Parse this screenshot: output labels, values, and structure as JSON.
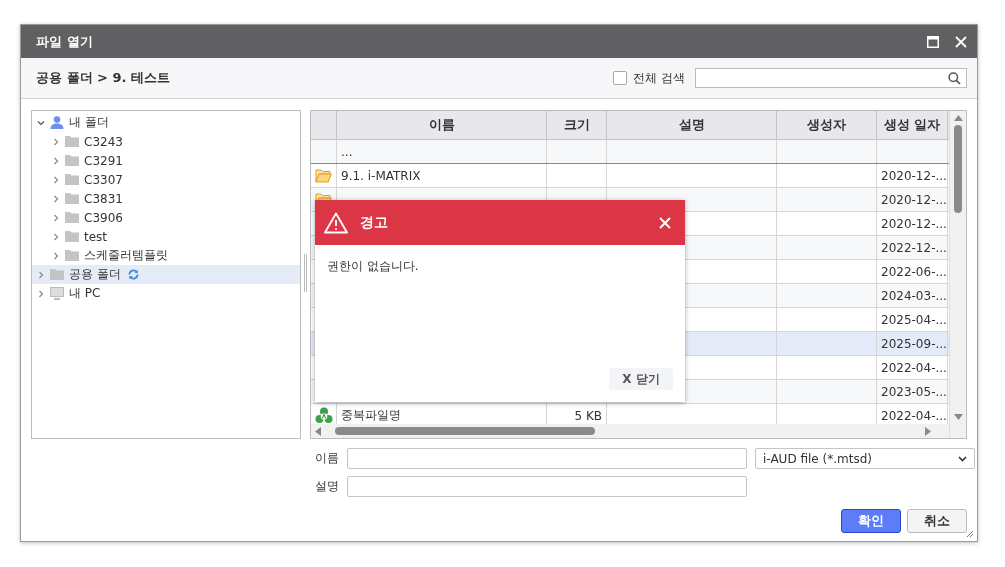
{
  "window": {
    "title": "파일 열기"
  },
  "breadcrumb": "공용 폴더 > 9. 테스트",
  "search": {
    "label": "전체 검색",
    "checked": false
  },
  "tree": [
    {
      "label": "내 폴더",
      "kind": "user",
      "expanded": true,
      "selected": false,
      "sync": false,
      "children": [
        {
          "label": "C3243",
          "kind": "folder",
          "expanded": false,
          "selected": false,
          "sync": false
        },
        {
          "label": "C3291",
          "kind": "folder",
          "expanded": false,
          "selected": false,
          "sync": false
        },
        {
          "label": "C3307",
          "kind": "folder",
          "expanded": false,
          "selected": false,
          "sync": false
        },
        {
          "label": "C3831",
          "kind": "folder",
          "expanded": false,
          "selected": false,
          "sync": false
        },
        {
          "label": "C3906",
          "kind": "folder",
          "expanded": false,
          "selected": false,
          "sync": false
        },
        {
          "label": "test",
          "kind": "folder",
          "expanded": false,
          "selected": false,
          "sync": false
        },
        {
          "label": "스케줄러템플릿",
          "kind": "folder",
          "expanded": false,
          "selected": false,
          "sync": false
        }
      ]
    },
    {
      "label": "공용 폴더",
      "kind": "folder",
      "expanded": false,
      "selected": true,
      "sync": true
    },
    {
      "label": "내 PC",
      "kind": "pc",
      "expanded": false,
      "selected": false,
      "sync": false
    }
  ],
  "table": {
    "columns": [
      "이름",
      "크기",
      "설명",
      "생성자",
      "생성 일자"
    ],
    "rows": [
      {
        "kind": "parent",
        "name": "...",
        "selected": false
      },
      {
        "kind": "folder",
        "name": "9.1. i-MATRIX",
        "date": "2020-12-...",
        "selected": false
      },
      {
        "kind": "folder",
        "date": "2020-12-...",
        "selected": false
      },
      {
        "kind": "hidden",
        "date": "2020-12-...",
        "selected": false
      },
      {
        "kind": "hidden",
        "date": "2022-12-...",
        "selected": false
      },
      {
        "kind": "hidden",
        "date": "2022-06-...",
        "selected": false
      },
      {
        "kind": "hidden",
        "date": "2024-03-...",
        "selected": false
      },
      {
        "kind": "hidden",
        "date": "2025-04-...",
        "selected": false
      },
      {
        "kind": "hidden",
        "date": "2025-09-...",
        "selected": true
      },
      {
        "kind": "hidden",
        "date": "2022-04-...",
        "selected": false
      },
      {
        "kind": "hidden",
        "date": "2023-05-...",
        "selected": false
      },
      {
        "kind": "report",
        "name": "중복파일명",
        "size": "5 KB",
        "date": "2022-04-...",
        "selected": false
      }
    ]
  },
  "form": {
    "name_label": "이름",
    "description_label": "설명",
    "file_type": "i-AUD file (*.mtsd)"
  },
  "buttons": [
    {
      "label": "확인",
      "kind": "primary"
    },
    {
      "label": "취소",
      "kind": "default"
    }
  ],
  "alert": {
    "title": "경고",
    "message": "권한이 없습니다.",
    "close_label": "X 닫기"
  }
}
